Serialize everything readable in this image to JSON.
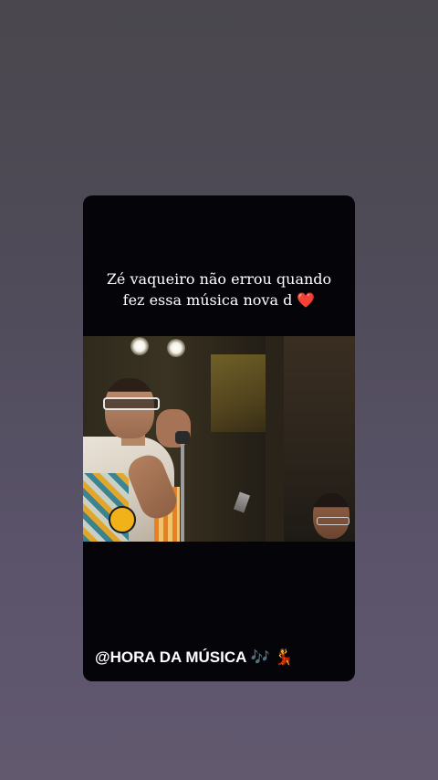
{
  "story": {
    "caption_line1": "Zé vaqueiro não errou quando",
    "caption_line2": "fez essa música nova d",
    "caption_heart": "❤️",
    "footer_text": "@HORA DA MÚSICA",
    "footer_emoji_notes": "🎶",
    "footer_emoji_dancer": "💃"
  },
  "colors": {
    "background": "#4f4b58",
    "card": "#050409",
    "caption_text": "#ffffff",
    "heart": "#e0162b"
  },
  "icons": {
    "heart": "heart-icon",
    "notes": "music-notes-icon",
    "dancer": "dancer-icon"
  }
}
